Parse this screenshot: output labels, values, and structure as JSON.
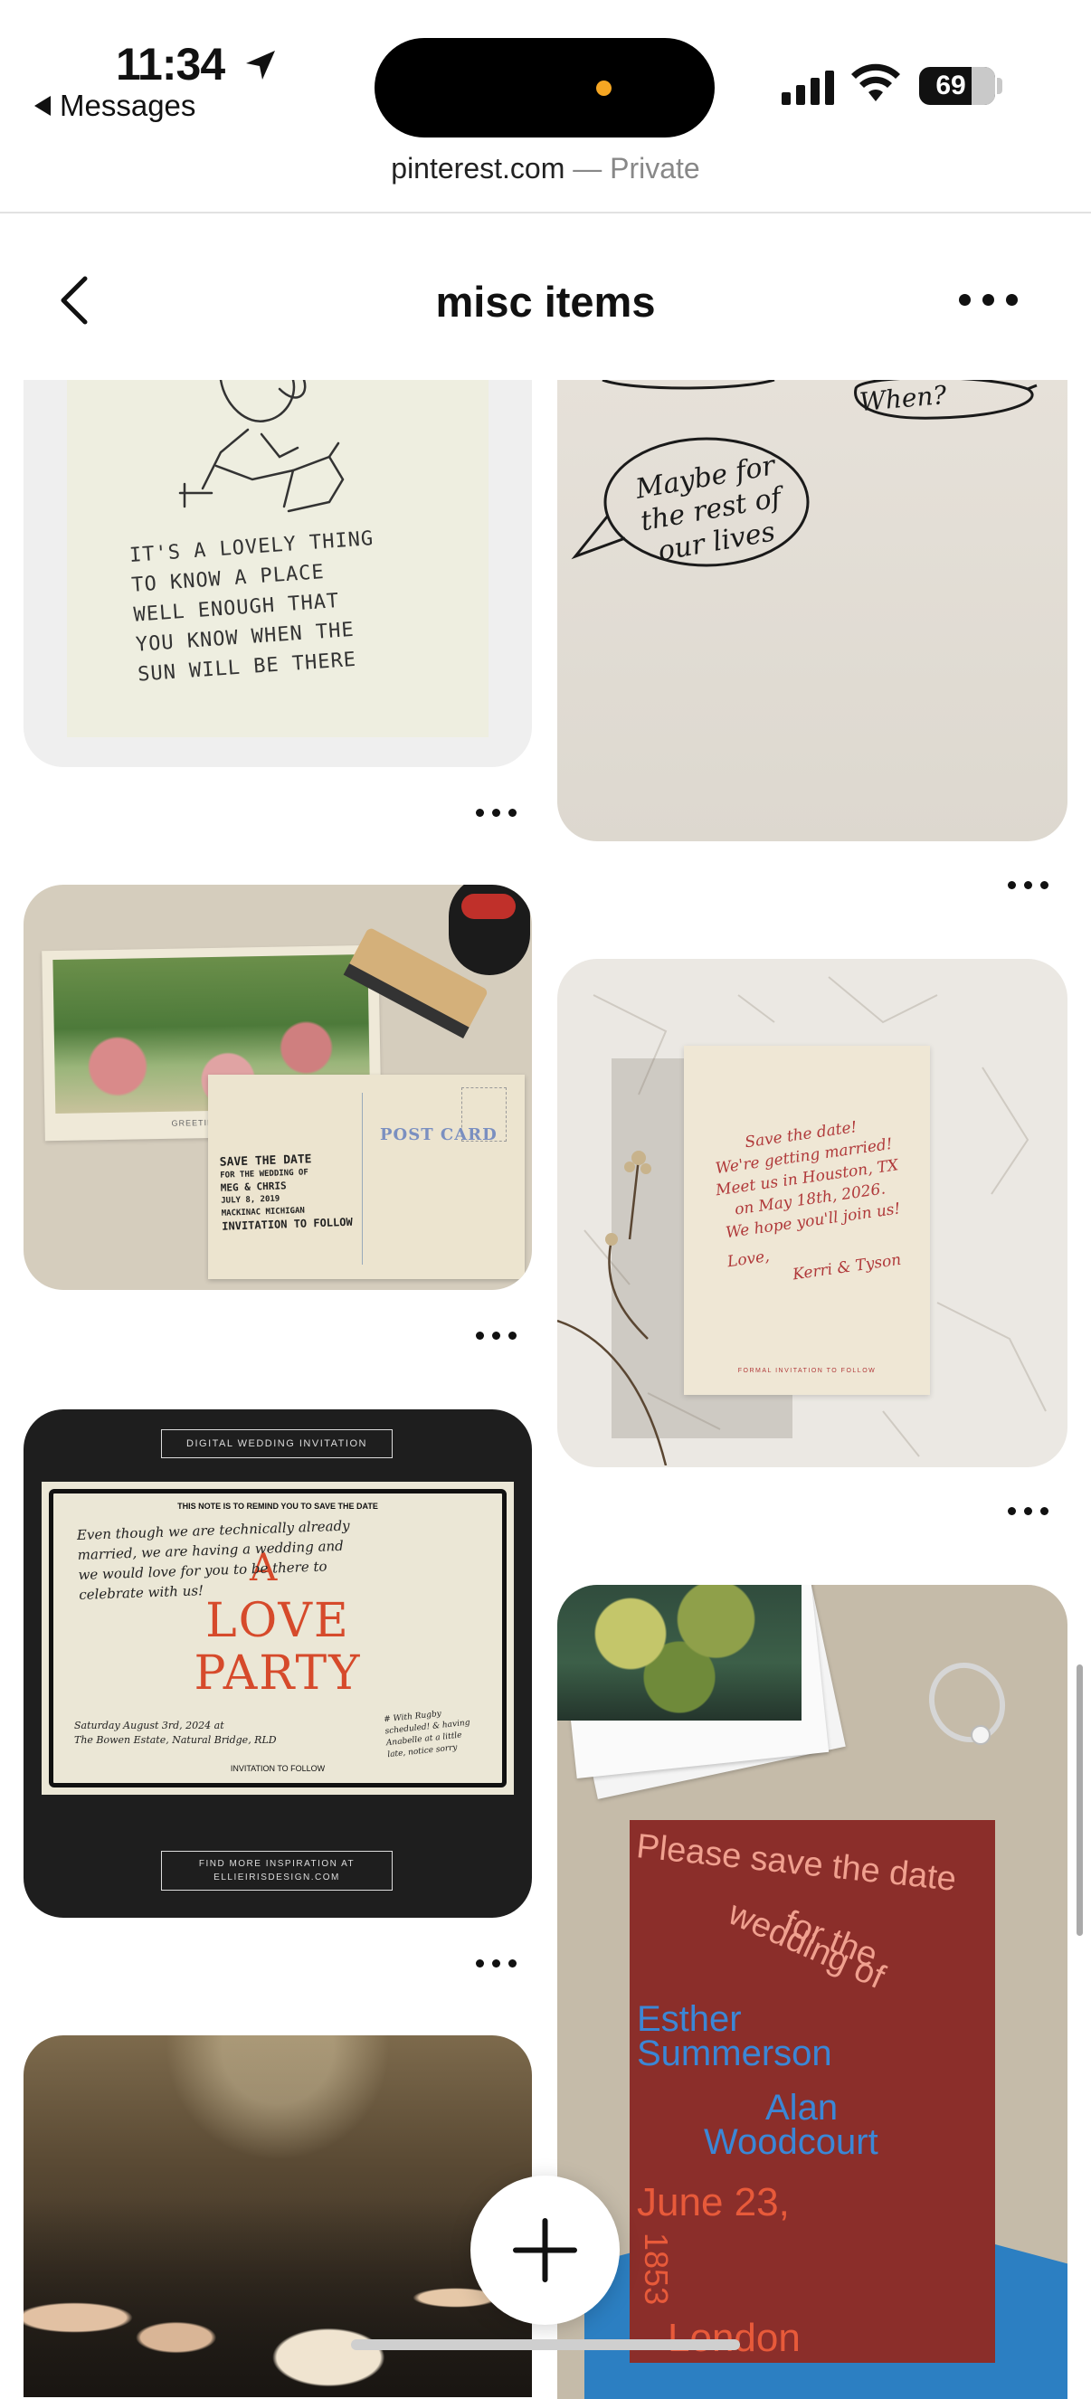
{
  "status": {
    "time": "11:34",
    "back_app": "Messages",
    "battery": "69",
    "battery_level": 0.69
  },
  "browser": {
    "domain": "pinterest.com",
    "separator": " — ",
    "mode": "Private"
  },
  "board": {
    "title": "misc items"
  },
  "pins": {
    "p1": {
      "lines": [
        "IT'S  A  LOVELY  THING",
        "TO  KNOW  A  PLACE",
        "WELL  ENOUGH  THAT",
        "YOU  KNOW  WHEN  THE",
        "SUN  WILL  BE  THERE"
      ]
    },
    "p2": {
      "bubble_small": "When?",
      "bubble_big": [
        "Maybe for",
        "the rest of",
        "our lives"
      ]
    },
    "p3": {
      "card_lines": [
        "SAVE THE DATE",
        "FOR THE WEDDING OF",
        "MEG & CHRIS",
        "JULY 8, 2019",
        "MACKINAC MICHIGAN",
        "INVITATION TO FOLLOW"
      ],
      "stamp": "POST CARD",
      "caption": "GREETINGS FROM"
    },
    "p4": {
      "lines": [
        "Save the date!",
        "We're getting married!",
        "Meet us in Houston, TX",
        "on May 18th, 2026.",
        "We hope you'll join us!",
        "Love,",
        "Kerri & Tyson"
      ],
      "footer": "FORMAL INVITATION TO FOLLOW"
    },
    "p5": {
      "top_label": "DIGITAL WEDDING INVITATION",
      "note": "THIS NOTE IS TO REMIND YOU TO SAVE THE DATE",
      "hand": [
        "Even though we are technically already",
        "married, we are having a wedding and",
        "we would love for you to be there to",
        "celebrate with us!"
      ],
      "big_a": "A",
      "big1": "LOVE",
      "big2": "PARTY",
      "date": [
        "Saturday August 3rd, 2024 at",
        "The Bowen Estate, Natural Bridge, RLD"
      ],
      "side": [
        "# With Rugby",
        "scheduled! & having",
        "Anabelle at a little",
        "late, notice sorry"
      ],
      "follow": "INVITATION TO FOLLOW",
      "bottom1": "FIND MORE INSPIRATION AT",
      "bottom2": "ELLIEIRISDESIGN.COM"
    },
    "p6": {
      "line1": "Please save the date",
      "line2": "for the",
      "line3": "wedding of",
      "name1a": "Esther",
      "name1b": "Summerson",
      "name2a": "Alan",
      "name2b": "Woodcourt",
      "date": "June 23,",
      "year": "1853",
      "place": "London"
    }
  }
}
